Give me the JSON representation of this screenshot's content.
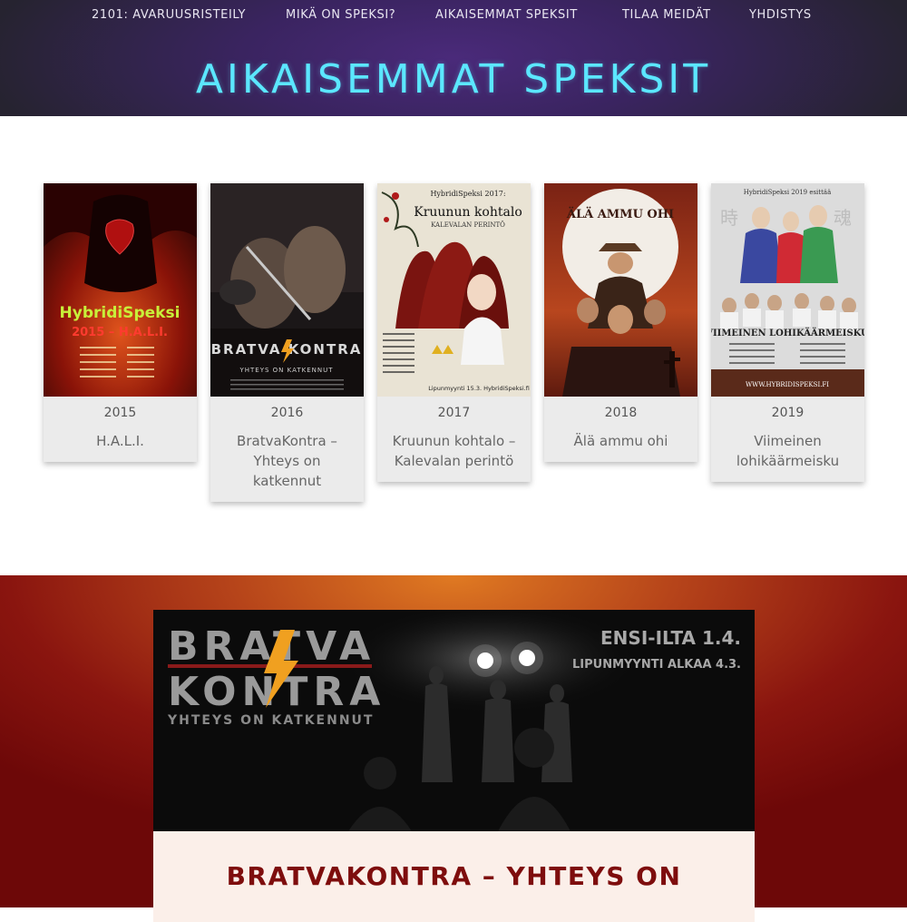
{
  "nav": {
    "items": [
      {
        "label": "2101: AVARUUSRISTEILY"
      },
      {
        "label": "MIKÄ ON SPEKSI?"
      },
      {
        "label": "AIKAISEMMAT SPEKSIT"
      },
      {
        "label": "TILAA MEIDÄT"
      },
      {
        "label": "YHDISTYS"
      }
    ]
  },
  "page": {
    "title": "AIKAISEMMAT SPEKSIT"
  },
  "shows": [
    {
      "year": "2015",
      "name": "H.A.L.I.",
      "poster": {
        "title": "HybridiSpeksi",
        "subtitle": "2015 – H.A.L.I."
      }
    },
    {
      "year": "2016",
      "name": "BratvaKontra – Yhteys on katkennut",
      "poster": {
        "title": "BRATVA KONTRA",
        "subtitle": "YHTEYS ON KATKENNUT"
      }
    },
    {
      "year": "2017",
      "name": "Kruunun kohtalo – Kalevalan perintö",
      "poster": {
        "top": "HybridiSpeksi 2017:",
        "title": "Kruunun kohtalo",
        "subtitle": "KALEVALAN PERINTÖ",
        "footer": "Lipunmyynti 15.3. HybridiSpeksi.fi"
      }
    },
    {
      "year": "2018",
      "name": "Älä ammu ohi",
      "poster": {
        "title": "ÄLÄ AMMU OHI"
      }
    },
    {
      "year": "2019",
      "name": "Viimeinen lohikäärmeisku",
      "poster": {
        "top": "HybridiSpeksi 2019 esittää",
        "title": "VIIMEINEN LOHIKÄÄRMEISKU",
        "footer": "WWW.HYBRIDISPEKSI.FI"
      }
    }
  ],
  "feature": {
    "banner": {
      "logo_line1": "BRATVA",
      "logo_line2": "KONTRA",
      "logo_tagline": "YHTEYS ON KATKENNUT",
      "premiere": "ENSI-ILTA 1.4.",
      "tickets": "LIPUNMYYNTI ALKAA 4.3."
    },
    "title": "BRATVAKONTRA – YHTEYS ON"
  },
  "colors": {
    "accent_title": "#5be7ff",
    "feature_title": "#7e0d0d"
  }
}
